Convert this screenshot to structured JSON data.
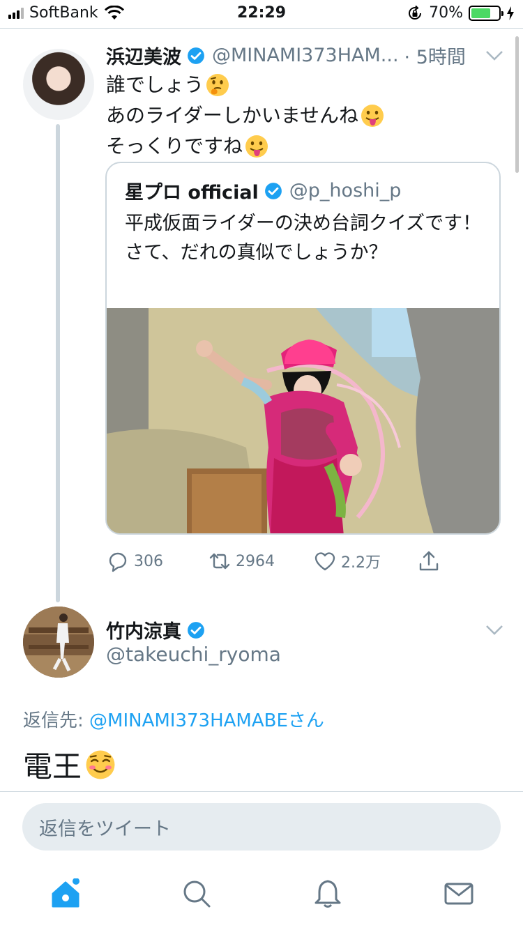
{
  "status_bar": {
    "carrier": "SoftBank",
    "time": "22:29",
    "battery_percent": "70%",
    "battery_level": 0.7
  },
  "tweet": {
    "author_name": "浜辺美波",
    "author_handle": "@MINAMI373HAM...",
    "time_ago": "· 5時間",
    "lines": [
      "誰でしょう",
      "あのライダーしかいませんね",
      "そっくりですね"
    ],
    "line_emojis": [
      "thinking-face-emoji",
      "tongue-out-emoji",
      "tongue-out-emoji"
    ],
    "quoted": {
      "author_name": "星プロ official",
      "author_handle": "@p_hoshi_p",
      "text": "平成仮面ライダーの決め台詞クイズです！\nさて、だれの真似でしょうか？",
      "image": "photo-pink-costume-person"
    },
    "actions": {
      "replies": "306",
      "retweets": "2964",
      "likes": "2.2万"
    }
  },
  "reply": {
    "author_name": "竹内涼真",
    "author_handle": "@takeuchi_ryoma",
    "replying_label": "返信先: ",
    "replying_to": "@MINAMI373HAMABEさん",
    "text": "電王",
    "emoji": "smiling-face-emoji"
  },
  "compose": {
    "placeholder": "返信をツイート"
  },
  "tabs": [
    "home-icon",
    "search-icon",
    "notifications-icon",
    "messages-icon"
  ],
  "colors": {
    "accent": "#1da1f2",
    "secondary_text": "#657786",
    "battery_fill": "#4cd964"
  }
}
